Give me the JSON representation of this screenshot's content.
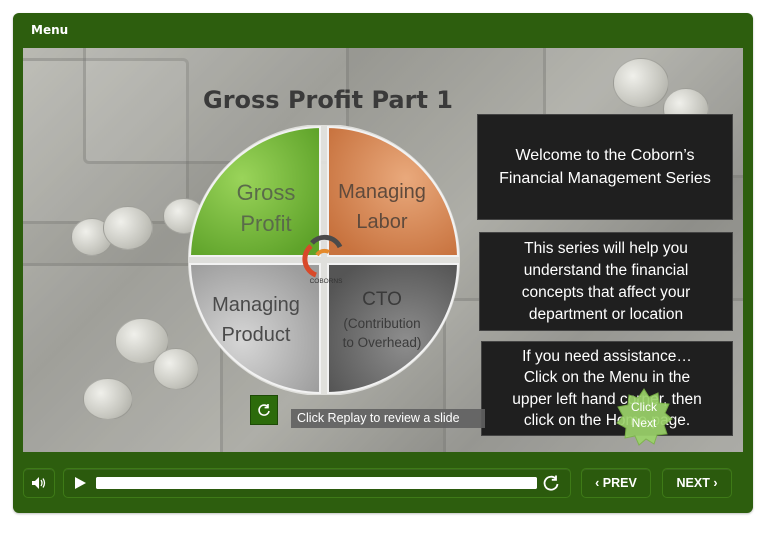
{
  "menu": {
    "label": "Menu"
  },
  "slide": {
    "title": "Gross Profit Part 1",
    "wheel": {
      "gross_profit": [
        "Gross",
        "Profit"
      ],
      "managing_labor": [
        "Managing",
        "Labor"
      ],
      "managing_product": [
        "Managing",
        "Product"
      ],
      "cto": [
        "CTO",
        "(Contribution",
        "to Overhead)"
      ],
      "logo_text": "COBORNS"
    },
    "info_boxes": [
      [
        "Welcome to the Coborn’s",
        "Financial Management Series"
      ],
      [
        "This series will help you",
        "understand the financial",
        "concepts that affect your",
        "department or location"
      ],
      [
        "If you need assistance…",
        "Click on the Menu in the",
        "upper left hand corner, then",
        "click on the Home page."
      ]
    ],
    "replay": {
      "label": "Click Replay to review a slide"
    },
    "badge": {
      "line1": "Click",
      "line2": "Next"
    }
  },
  "controls": {
    "prev": "PREV",
    "next": "NEXT",
    "prev_icon": "chevron-left-icon",
    "next_icon": "chevron-right-icon",
    "volume_icon": "speaker-icon",
    "play_icon": "play-icon",
    "reset_icon": "replay-icon",
    "progress": 1.0
  },
  "colors": {
    "frame": "#2d5e0e",
    "gross_profit": "#7cc142",
    "managing_labor": "#d98b5a",
    "managing_product": "#bdbdbd",
    "cto": "#757575",
    "badge": "#9bd36a"
  }
}
